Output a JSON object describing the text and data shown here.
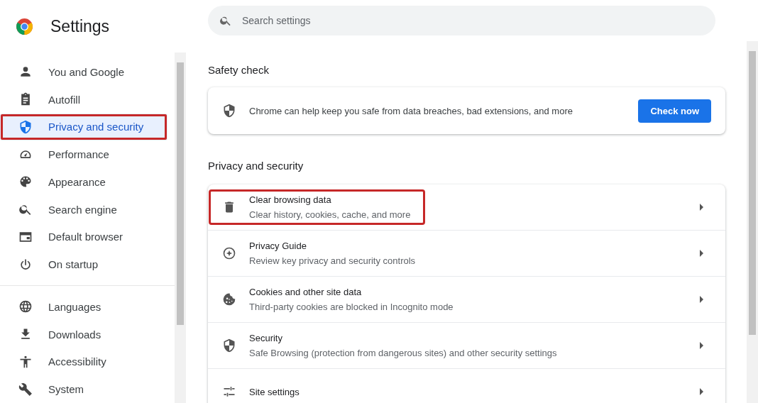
{
  "header": {
    "title": "Settings"
  },
  "search": {
    "placeholder": "Search settings"
  },
  "sidebar": {
    "groups": [
      [
        {
          "label": "You and Google",
          "kind": "person",
          "selected": false,
          "highlighted": false
        },
        {
          "label": "Autofill",
          "kind": "clipboard",
          "selected": false,
          "highlighted": false
        },
        {
          "label": "Privacy and security",
          "kind": "shield",
          "selected": true,
          "highlighted": true
        },
        {
          "label": "Performance",
          "kind": "gauge",
          "selected": false,
          "highlighted": false
        },
        {
          "label": "Appearance",
          "kind": "palette",
          "selected": false,
          "highlighted": false
        },
        {
          "label": "Search engine",
          "kind": "search",
          "selected": false,
          "highlighted": false
        },
        {
          "label": "Default browser",
          "kind": "browser",
          "selected": false,
          "highlighted": false
        },
        {
          "label": "On startup",
          "kind": "power",
          "selected": false,
          "highlighted": false
        }
      ],
      [
        {
          "label": "Languages",
          "kind": "globe",
          "selected": false,
          "highlighted": false
        },
        {
          "label": "Downloads",
          "kind": "download",
          "selected": false,
          "highlighted": false
        },
        {
          "label": "Accessibility",
          "kind": "accessibility",
          "selected": false,
          "highlighted": false
        },
        {
          "label": "System",
          "kind": "wrench",
          "selected": false,
          "highlighted": false
        }
      ]
    ]
  },
  "safety_check": {
    "heading": "Safety check",
    "text": "Chrome can help keep you safe from data breaches, bad extensions, and more",
    "button": "Check now"
  },
  "privacy": {
    "heading": "Privacy and security",
    "rows": [
      {
        "title": "Clear browsing data",
        "subtitle": "Clear history, cookies, cache, and more",
        "kind": "trash",
        "highlighted": true
      },
      {
        "title": "Privacy Guide",
        "subtitle": "Review key privacy and security controls",
        "kind": "compass",
        "highlighted": false
      },
      {
        "title": "Cookies and other site data",
        "subtitle": "Third-party cookies are blocked in Incognito mode",
        "kind": "cookie",
        "highlighted": false
      },
      {
        "title": "Security",
        "subtitle": "Safe Browsing (protection from dangerous sites) and other security settings",
        "kind": "shield",
        "highlighted": false
      },
      {
        "title": "Site settings",
        "kind": "sliders",
        "highlighted": false
      }
    ]
  }
}
